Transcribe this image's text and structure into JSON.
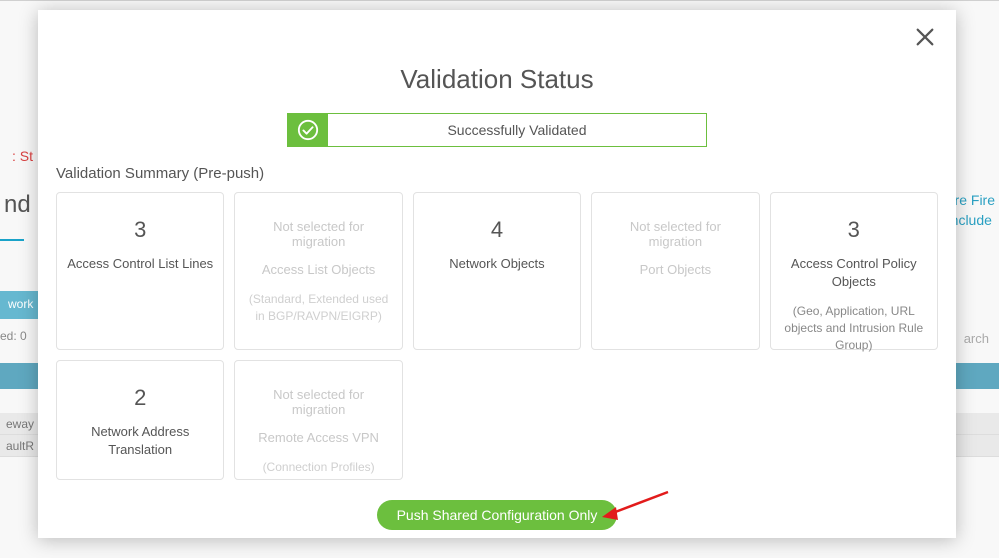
{
  "background": {
    "status_frag": ": St",
    "left_frag": "nd",
    "network_btn": "work",
    "selected_frag": "ed: 0",
    "greyrow1": "eway",
    "greyrow2": "aultR",
    "right_link_l1": "ure Fire",
    "right_link_l2": "Include",
    "search_frag": "arch"
  },
  "modal": {
    "title": "Validation Status",
    "status_text": "Successfully Validated",
    "summary_label": "Validation Summary (Pre-push)",
    "cards": {
      "acl": {
        "count": "3",
        "label": "Access Control List Lines"
      },
      "alo": {
        "nsm": "Not selected for migration",
        "label": "Access List Objects",
        "sub": "(Standard, Extended used in BGP/RAVPN/EIGRP)"
      },
      "netobj": {
        "count": "4",
        "label": "Network Objects"
      },
      "portobj": {
        "nsm": "Not selected for migration",
        "label": "Port Objects"
      },
      "acpo": {
        "count": "3",
        "label": "Access Control Policy Objects",
        "sub": "(Geo, Application, URL objects and Intrusion Rule Group)"
      },
      "nat": {
        "count": "2",
        "label": "Network Address Translation"
      },
      "ravpn": {
        "nsm": "Not selected for migration",
        "label": "Remote Access VPN",
        "sub": "(Connection Profiles)"
      }
    },
    "push_button": "Push Shared Configuration Only"
  }
}
